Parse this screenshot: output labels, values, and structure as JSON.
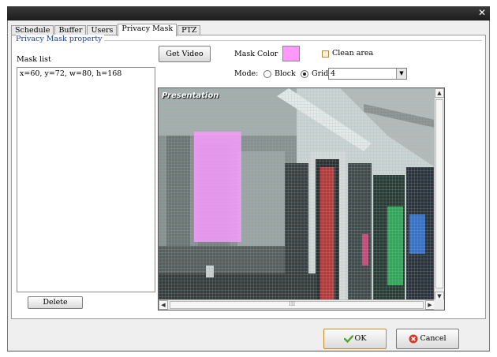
{
  "tabs": [
    {
      "label": "Schedule",
      "active": false
    },
    {
      "label": "Buffer",
      "active": false
    },
    {
      "label": "Users",
      "active": false
    },
    {
      "label": "Privacy Mask",
      "active": true
    },
    {
      "label": "PTZ",
      "active": false
    }
  ],
  "group_title": "Privacy Mask property",
  "mask_list": {
    "label": "Mask list",
    "items": [
      "x=60, y=72, w=80, h=168"
    ]
  },
  "buttons": {
    "get_video": "Get Video",
    "delete": "Delete",
    "ok": "OK",
    "cancel": "Cancel"
  },
  "mask_color": {
    "label": "Mask Color",
    "color": "#ff99ff"
  },
  "clean_area": {
    "label": "Clean area",
    "checked": false
  },
  "mode": {
    "label": "Mode:",
    "options": [
      "Block",
      "Grid"
    ],
    "selected": "Grid",
    "grid_value": "4"
  },
  "video": {
    "overlay_label": "Presentation",
    "scrollbar_track": "III"
  },
  "colors": {
    "accent_title": "#1a3fa8",
    "window_bar": "#222222",
    "ok_check": "#5aa02c",
    "cancel_icon": "#d23a2a"
  },
  "icons": [
    "close-icon",
    "check-icon",
    "cancel-icon",
    "chevron-down-icon"
  ]
}
